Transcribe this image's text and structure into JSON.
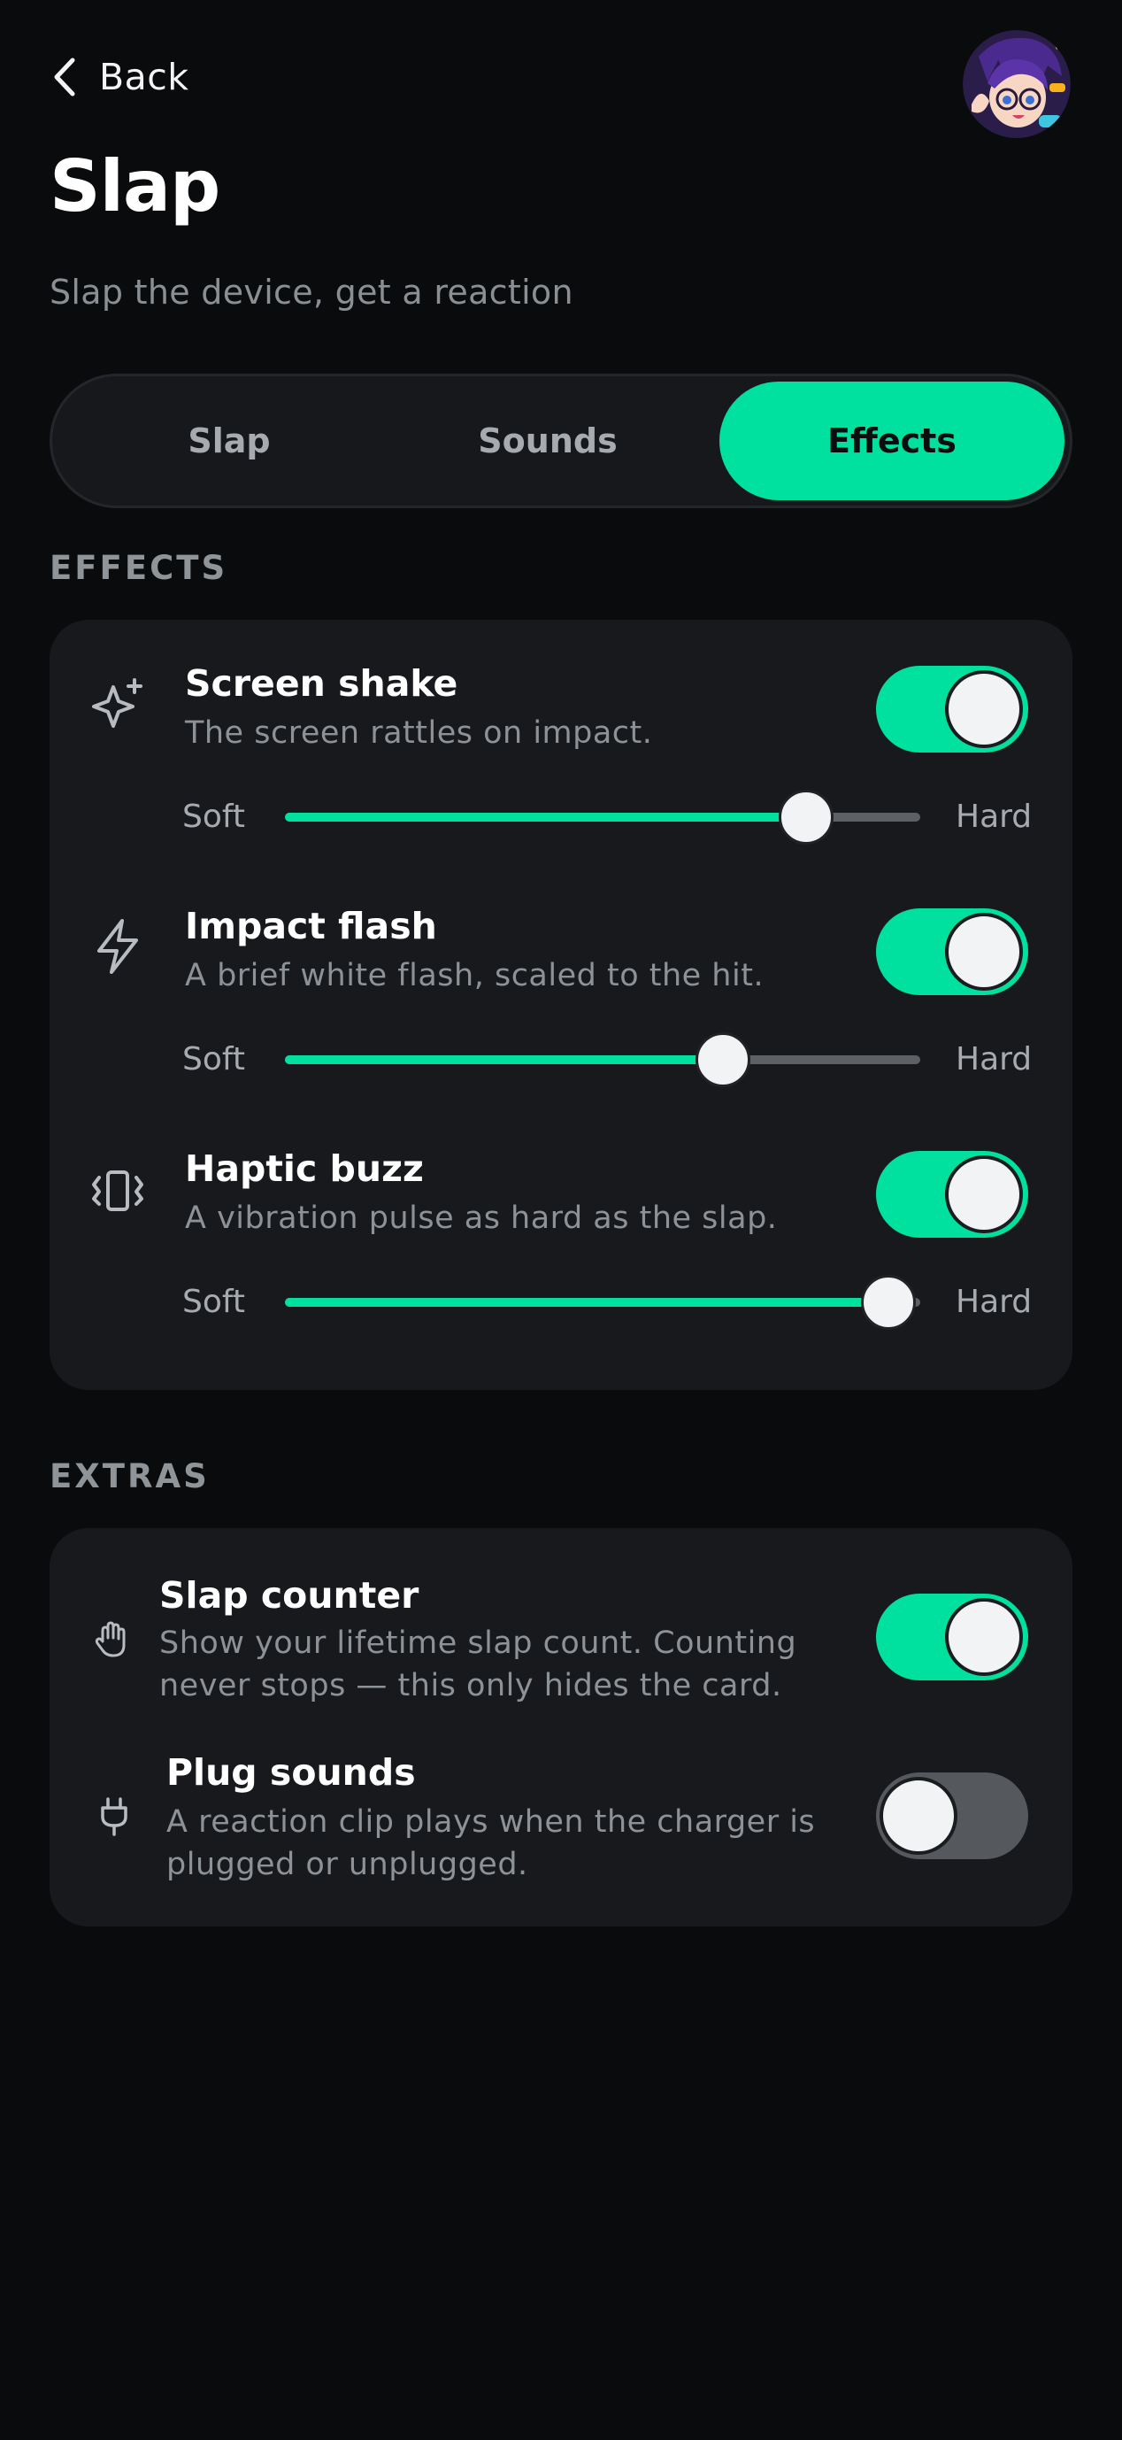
{
  "header": {
    "back_label": "Back"
  },
  "page": {
    "title": "Slap",
    "subtitle": "Slap the device, get a reaction"
  },
  "tabs": [
    {
      "label": "Slap",
      "active": false
    },
    {
      "label": "Sounds",
      "active": false
    },
    {
      "label": "Effects",
      "active": true
    }
  ],
  "effects": {
    "section_label": "EFFECTS",
    "items": [
      {
        "icon": "sparkle-icon",
        "title": "Screen shake",
        "desc": "The screen rattles on impact.",
        "enabled": true,
        "slider": {
          "min_label": "Soft",
          "max_label": "Hard",
          "value": 0.82
        }
      },
      {
        "icon": "lightning-icon",
        "title": "Impact flash",
        "desc": "A brief white flash, scaled to the hit.",
        "enabled": true,
        "slider": {
          "min_label": "Soft",
          "max_label": "Hard",
          "value": 0.69
        }
      },
      {
        "icon": "vibrate-icon",
        "title": "Haptic buzz",
        "desc": "A vibration pulse as hard as the slap.",
        "enabled": true,
        "slider": {
          "min_label": "Soft",
          "max_label": "Hard",
          "value": 0.95
        }
      }
    ]
  },
  "extras": {
    "section_label": "EXTRAS",
    "items": [
      {
        "icon": "hand-icon",
        "title": "Slap counter",
        "desc_line1": "Show your lifetime slap count. Counting",
        "desc_line2": "never stops — this only hides the card.",
        "enabled": true
      },
      {
        "icon": "plug-icon",
        "title": "Plug sounds",
        "desc_line1": "A reaction clip plays when the charger is",
        "desc_line2": "plugged or unplugged.",
        "enabled": false
      }
    ]
  },
  "colors": {
    "accent": "#00e09e",
    "background": "#0a0b0d",
    "card": "#17191c",
    "muted": "#8d9297"
  }
}
